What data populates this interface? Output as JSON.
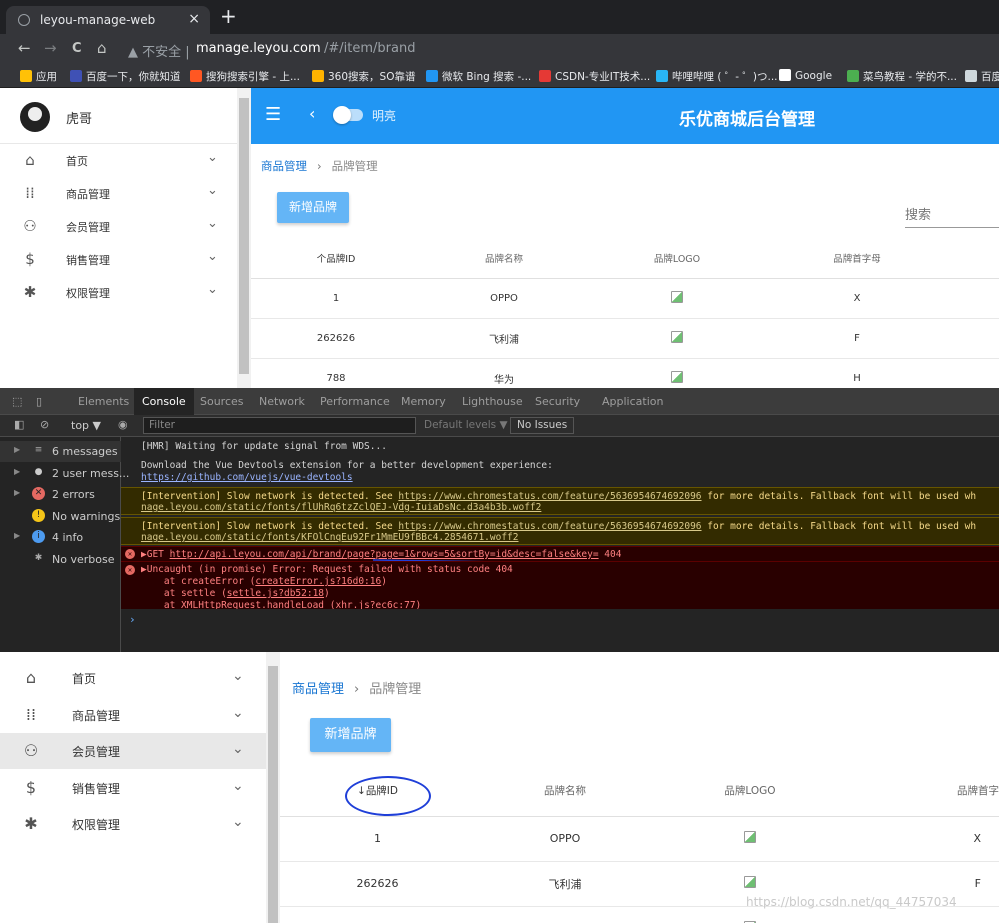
{
  "browser": {
    "tab_title": "leyou-manage-web",
    "tab_close": "×",
    "new_tab": "+",
    "nav": {
      "back": "←",
      "forward": "→",
      "reload": "C",
      "home": "⌂"
    },
    "url_warning": "▲ 不安全 |",
    "url_host": "manage.leyou.com",
    "url_path": "/#/item/brand",
    "bookmarks": [
      {
        "label": "应用",
        "color": "#ffc107"
      },
      {
        "label": "百度一下，你就知道",
        "color": "#3f51b5"
      },
      {
        "label": "搜狗搜索引擎 - 上...",
        "color": "#ff5722"
      },
      {
        "label": "360搜索，SO靠谱",
        "color": "#ffb300"
      },
      {
        "label": "微软 Bing 搜索 -...",
        "color": "#2196f3"
      },
      {
        "label": "CSDN-专业IT技术...",
        "color": "#e53935"
      },
      {
        "label": "哔哩哔哩 ( ゜- ゜)つ...",
        "color": "#29b6f6"
      },
      {
        "label": "Google",
        "color": "#ffffff"
      },
      {
        "label": "菜鸟教程 - 学的不...",
        "color": "#4caf50"
      },
      {
        "label": "百度",
        "color": "#cfd8dc"
      }
    ]
  },
  "app": {
    "user_name": "虎哥",
    "title": "乐优商城后台管理",
    "mode_label": "明亮",
    "menu": [
      {
        "label": "首页",
        "icon": "home-icon"
      },
      {
        "label": "商品管理",
        "icon": "grid-icon"
      },
      {
        "label": "会员管理",
        "icon": "people-icon"
      },
      {
        "label": "销售管理",
        "icon": "dollar-icon"
      },
      {
        "label": "权限管理",
        "icon": "gear-icon"
      }
    ],
    "breadcrumb": {
      "parent": "商品管理",
      "current": "品牌管理"
    },
    "add_button": "新增品牌",
    "search_placeholder": "搜索",
    "columns": {
      "id_asc": "个品牌ID",
      "id_desc": "品牌ID",
      "name": "品牌名称",
      "logo": "品牌LOGO",
      "letter": "品牌首字母",
      "letter_cut": "品牌首字"
    },
    "rows": [
      {
        "id": "1",
        "name": "OPPO",
        "letter": "X"
      },
      {
        "id": "262626",
        "name": "飞利浦",
        "letter": "F"
      },
      {
        "id": "788",
        "name": "华为",
        "letter": "H"
      }
    ]
  },
  "devtools": {
    "tabs": [
      "Elements",
      "Console",
      "Sources",
      "Network",
      "Performance",
      "Memory",
      "Lighthouse",
      "Security",
      "Application"
    ],
    "active_tab": "Console",
    "context": "top ▼",
    "filter_placeholder": "Filter",
    "levels": "Default levels ▼",
    "no_issues": "No Issues",
    "sidebar": [
      {
        "label": "6 messages",
        "icon": "list-icon"
      },
      {
        "label": "2 user mess...",
        "icon": "user-icon"
      },
      {
        "label": "2 errors",
        "icon": "error-icon"
      },
      {
        "label": "No warnings",
        "icon": "warning-icon"
      },
      {
        "label": "4 info",
        "icon": "info-icon"
      },
      {
        "label": "No verbose",
        "icon": "bug-icon"
      }
    ],
    "logs": {
      "hmr": "[HMR] Waiting for update signal from WDS...",
      "vue1": "Download the Vue Devtools extension for a better development experience:",
      "vue2": "https://github.com/vuejs/vue-devtools",
      "warn_pre": "[Intervention] Slow network is detected. See ",
      "warn_link": "https://www.chromestatus.com/feature/5636954674692096",
      "warn_post": " for more details. Fallback font will be used wh",
      "warn1_line2": "nage.leyou.com/static/fonts/flUhRq6tzZclQEJ-Vdg-IuiaDsNc.d3a4b3b.woff2",
      "warn2_line2": "nage.leyou.com/static/fonts/KFOlCnqEu92Fr1MmEU9fBBc4.2854671.woff2",
      "get_pre": "▶GET ",
      "get_url": "http://api.leyou.com/api/brand/page?page=1&rows=5&sortBy=id&desc=false&key=",
      "get_status": " 404",
      "uncaught": "▶Uncaught (in promise) Error: Request failed with status code 404",
      "stack1_pre": "    at createError (",
      "stack1_link": "createError.js?16d0:16",
      "stack2_pre": "    at settle (",
      "stack2_link": "settle.js?db52:18",
      "stack3_pre": "    at XMLHttpRequest.handleLoad (",
      "stack3_link": "xhr.js?ec6c:77",
      "close_paren": ")"
    }
  },
  "watermark": "https://blog.csdn.net/qq_44757034"
}
